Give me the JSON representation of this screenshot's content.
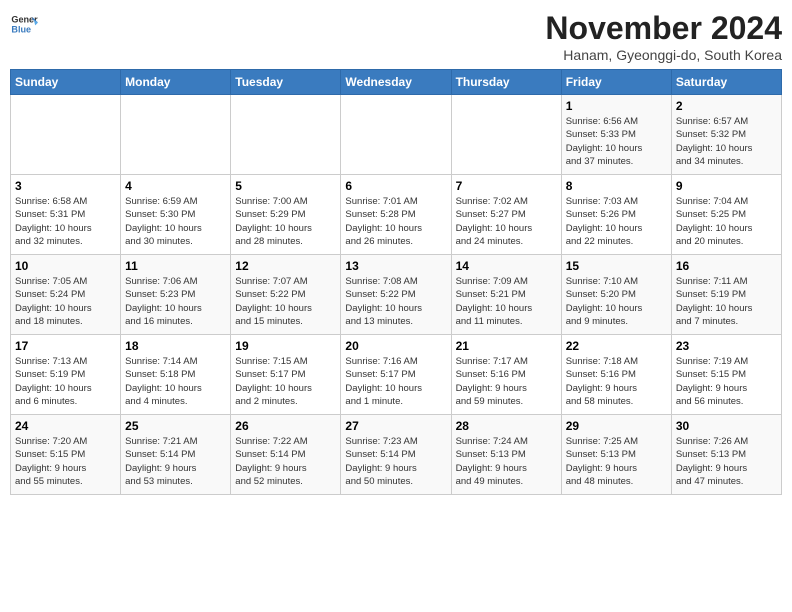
{
  "header": {
    "logo_line1": "General",
    "logo_line2": "Blue",
    "title": "November 2024",
    "subtitle": "Hanam, Gyeonggi-do, South Korea"
  },
  "weekdays": [
    "Sunday",
    "Monday",
    "Tuesday",
    "Wednesday",
    "Thursday",
    "Friday",
    "Saturday"
  ],
  "weeks": [
    [
      {
        "day": "",
        "text": ""
      },
      {
        "day": "",
        "text": ""
      },
      {
        "day": "",
        "text": ""
      },
      {
        "day": "",
        "text": ""
      },
      {
        "day": "",
        "text": ""
      },
      {
        "day": "1",
        "text": "Sunrise: 6:56 AM\nSunset: 5:33 PM\nDaylight: 10 hours\nand 37 minutes."
      },
      {
        "day": "2",
        "text": "Sunrise: 6:57 AM\nSunset: 5:32 PM\nDaylight: 10 hours\nand 34 minutes."
      }
    ],
    [
      {
        "day": "3",
        "text": "Sunrise: 6:58 AM\nSunset: 5:31 PM\nDaylight: 10 hours\nand 32 minutes."
      },
      {
        "day": "4",
        "text": "Sunrise: 6:59 AM\nSunset: 5:30 PM\nDaylight: 10 hours\nand 30 minutes."
      },
      {
        "day": "5",
        "text": "Sunrise: 7:00 AM\nSunset: 5:29 PM\nDaylight: 10 hours\nand 28 minutes."
      },
      {
        "day": "6",
        "text": "Sunrise: 7:01 AM\nSunset: 5:28 PM\nDaylight: 10 hours\nand 26 minutes."
      },
      {
        "day": "7",
        "text": "Sunrise: 7:02 AM\nSunset: 5:27 PM\nDaylight: 10 hours\nand 24 minutes."
      },
      {
        "day": "8",
        "text": "Sunrise: 7:03 AM\nSunset: 5:26 PM\nDaylight: 10 hours\nand 22 minutes."
      },
      {
        "day": "9",
        "text": "Sunrise: 7:04 AM\nSunset: 5:25 PM\nDaylight: 10 hours\nand 20 minutes."
      }
    ],
    [
      {
        "day": "10",
        "text": "Sunrise: 7:05 AM\nSunset: 5:24 PM\nDaylight: 10 hours\nand 18 minutes."
      },
      {
        "day": "11",
        "text": "Sunrise: 7:06 AM\nSunset: 5:23 PM\nDaylight: 10 hours\nand 16 minutes."
      },
      {
        "day": "12",
        "text": "Sunrise: 7:07 AM\nSunset: 5:22 PM\nDaylight: 10 hours\nand 15 minutes."
      },
      {
        "day": "13",
        "text": "Sunrise: 7:08 AM\nSunset: 5:22 PM\nDaylight: 10 hours\nand 13 minutes."
      },
      {
        "day": "14",
        "text": "Sunrise: 7:09 AM\nSunset: 5:21 PM\nDaylight: 10 hours\nand 11 minutes."
      },
      {
        "day": "15",
        "text": "Sunrise: 7:10 AM\nSunset: 5:20 PM\nDaylight: 10 hours\nand 9 minutes."
      },
      {
        "day": "16",
        "text": "Sunrise: 7:11 AM\nSunset: 5:19 PM\nDaylight: 10 hours\nand 7 minutes."
      }
    ],
    [
      {
        "day": "17",
        "text": "Sunrise: 7:13 AM\nSunset: 5:19 PM\nDaylight: 10 hours\nand 6 minutes."
      },
      {
        "day": "18",
        "text": "Sunrise: 7:14 AM\nSunset: 5:18 PM\nDaylight: 10 hours\nand 4 minutes."
      },
      {
        "day": "19",
        "text": "Sunrise: 7:15 AM\nSunset: 5:17 PM\nDaylight: 10 hours\nand 2 minutes."
      },
      {
        "day": "20",
        "text": "Sunrise: 7:16 AM\nSunset: 5:17 PM\nDaylight: 10 hours\nand 1 minute."
      },
      {
        "day": "21",
        "text": "Sunrise: 7:17 AM\nSunset: 5:16 PM\nDaylight: 9 hours\nand 59 minutes."
      },
      {
        "day": "22",
        "text": "Sunrise: 7:18 AM\nSunset: 5:16 PM\nDaylight: 9 hours\nand 58 minutes."
      },
      {
        "day": "23",
        "text": "Sunrise: 7:19 AM\nSunset: 5:15 PM\nDaylight: 9 hours\nand 56 minutes."
      }
    ],
    [
      {
        "day": "24",
        "text": "Sunrise: 7:20 AM\nSunset: 5:15 PM\nDaylight: 9 hours\nand 55 minutes."
      },
      {
        "day": "25",
        "text": "Sunrise: 7:21 AM\nSunset: 5:14 PM\nDaylight: 9 hours\nand 53 minutes."
      },
      {
        "day": "26",
        "text": "Sunrise: 7:22 AM\nSunset: 5:14 PM\nDaylight: 9 hours\nand 52 minutes."
      },
      {
        "day": "27",
        "text": "Sunrise: 7:23 AM\nSunset: 5:14 PM\nDaylight: 9 hours\nand 50 minutes."
      },
      {
        "day": "28",
        "text": "Sunrise: 7:24 AM\nSunset: 5:13 PM\nDaylight: 9 hours\nand 49 minutes."
      },
      {
        "day": "29",
        "text": "Sunrise: 7:25 AM\nSunset: 5:13 PM\nDaylight: 9 hours\nand 48 minutes."
      },
      {
        "day": "30",
        "text": "Sunrise: 7:26 AM\nSunset: 5:13 PM\nDaylight: 9 hours\nand 47 minutes."
      }
    ]
  ]
}
